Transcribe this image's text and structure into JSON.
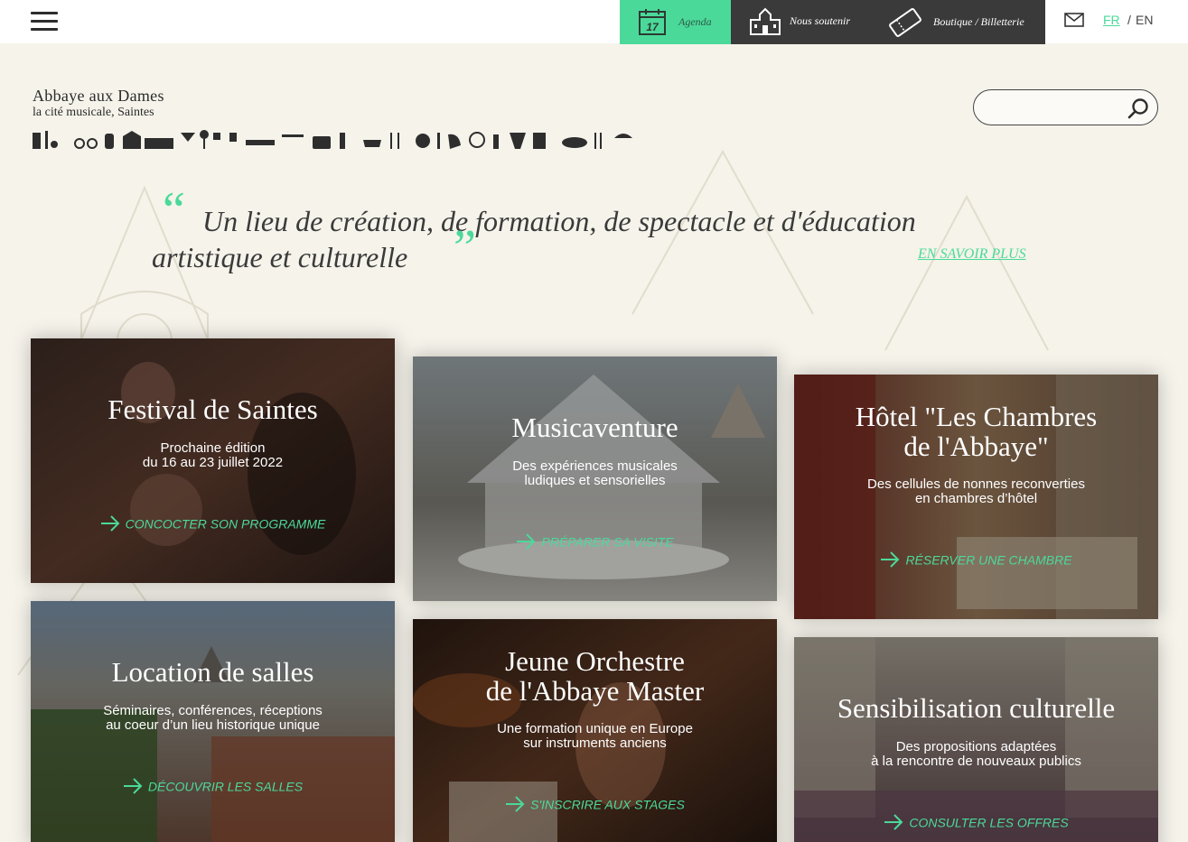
{
  "topbar": {
    "agenda": {
      "label": "Agenda",
      "day": "17"
    },
    "soutenir": {
      "label": "Nous soutenir"
    },
    "boutique": {
      "label": "Boutique / Billetterie"
    },
    "lang_fr": "FR",
    "lang_sep": "/",
    "lang_en": "EN"
  },
  "logo": {
    "title": "Abbaye aux Dames",
    "subtitle": "la cité musicale, Saintes"
  },
  "search": {
    "placeholder": "",
    "value": ""
  },
  "quote": {
    "line1": "Un lieu de création, de formation, de spectacle et d'éducation",
    "line2": "artistique et culturelle",
    "more": "EN SAVOIR PLUS"
  },
  "cards": [
    {
      "title": "Festival de Saintes",
      "desc": "Prochaine édition\ndu 16 au 23 juillet 2022",
      "cta": "CONCOCTER SON PROGRAMME"
    },
    {
      "title": "Musicaventure",
      "desc": "Des expériences musicales\nludiques et sensorielles",
      "cta": "PRÉPARER SA VISITE"
    },
    {
      "title": "Hôtel \"Les Chambres\nde l'Abbaye\"",
      "desc": "Des cellules de nonnes reconverties\nen chambres d’hôtel",
      "cta": "RÉSERVER UNE CHAMBRE"
    },
    {
      "title": "Location de salles",
      "desc": "Séminaires, conférences, réceptions\nau coeur d’un lieu historique unique",
      "cta": "DÉCOUVRIR LES SALLES"
    },
    {
      "title": "Jeune Orchestre\nde l'Abbaye Master",
      "desc": "Une formation unique en Europe\nsur instruments anciens",
      "cta": "S'INSCRIRE AUX STAGES"
    },
    {
      "title": "Sensibilisation culturelle",
      "desc": "Des propositions adaptées\nà la rencontre de nouveaux publics",
      "cta": "CONSULTER LES OFFRES"
    }
  ],
  "colors": {
    "accent": "#4bd99a",
    "dark_nav": "#3a3a3a",
    "background": "#f5f3ea"
  }
}
